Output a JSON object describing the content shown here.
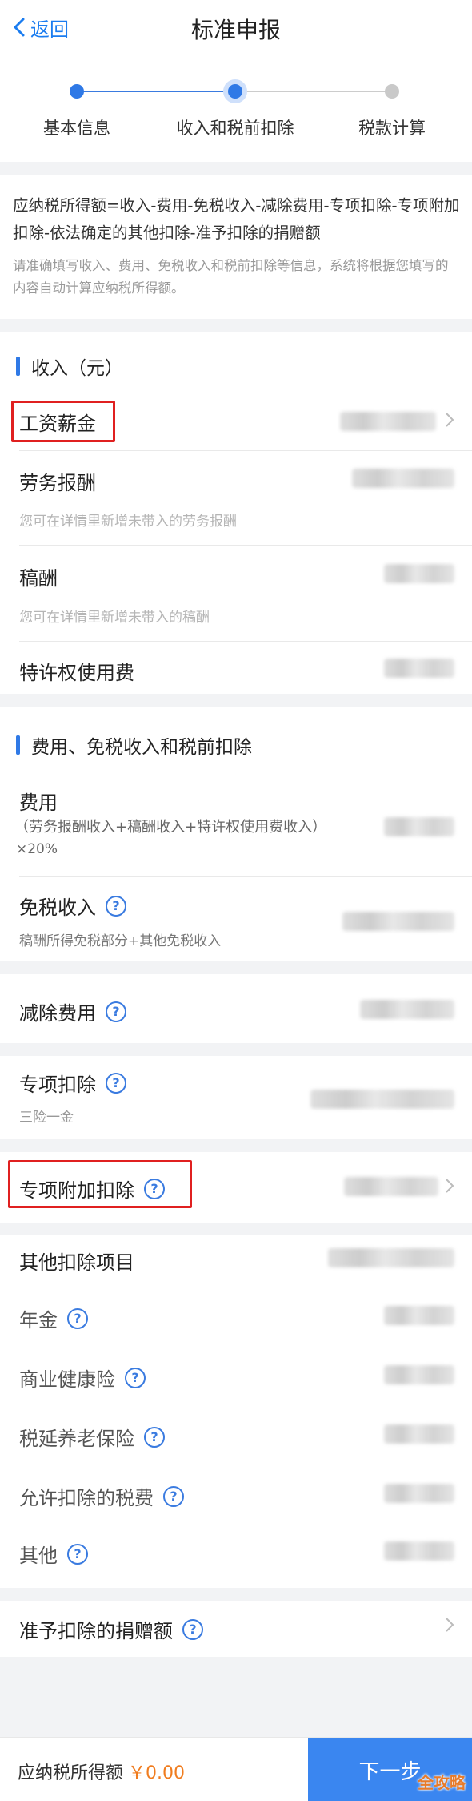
{
  "header": {
    "back_label": "返回",
    "title": "标准申报"
  },
  "steps": [
    {
      "label": "基本信息",
      "state": "done"
    },
    {
      "label": "收入和税前扣除",
      "state": "current"
    },
    {
      "label": "税款计算",
      "state": "pending"
    }
  ],
  "intro": {
    "formula": "应纳税所得额=收入-费用-免税收入-减除费用-专项扣除-专项附加扣除-依法确定的其他扣除-准予扣除的捐赠额",
    "hint": "请准确填写收入、费用、免税收入和税前扣除等信息，系统将根据您填写的内容自动计算应纳税所得额。"
  },
  "income": {
    "section_title": "收入（元）",
    "salary": "工资薪金",
    "labor": "劳务报酬",
    "labor_hint": "您可在详情里新增未带入的劳务报酬",
    "royalty": "稿酬",
    "royalty_hint": "您可在详情里新增未带入的稿酬",
    "franchise": "特许权使用费"
  },
  "deductions": {
    "section_title": "费用、免税收入和税前扣除",
    "expense": "费用",
    "expense_formula_1": "（劳务报酬收入+稿酬收入+特许权使用费收入）",
    "expense_formula_2": "×20%",
    "tax_free": "免税收入",
    "tax_free_hint": "稿酬所得免税部分+其他免税收入",
    "reduction": "减除费用",
    "special": "专项扣除",
    "special_hint": "三险一金",
    "special_additional": "专项附加扣除",
    "other": "其他扣除项目",
    "other_items": [
      "年金",
      "商业健康险",
      "税延养老保险",
      "允许扣除的税费",
      "其他"
    ],
    "donation": "准予扣除的捐赠额"
  },
  "footer": {
    "taxable_label": "应纳税所得额",
    "taxable_value": "￥0.00",
    "next_label": "下一步"
  },
  "icons": {
    "help": "question-circle-icon",
    "chevron": "chevron-right-icon",
    "back": "chevron-left-icon"
  },
  "watermark": "全攻略",
  "colors": {
    "accent": "#2f79e6",
    "highlight": "#e02020",
    "amount": "#f07c1e"
  }
}
